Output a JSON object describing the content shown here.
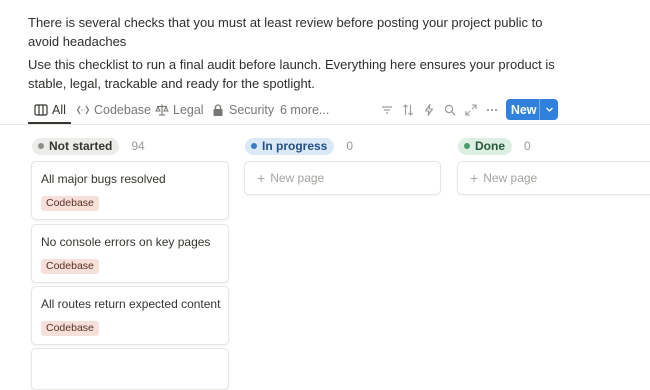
{
  "intro": {
    "paragraph1": "There is several checks that you must at least review before posting your project public to avoid headaches",
    "paragraph2": "Use this checklist to run a final audit before launch. Everything here ensures your product is stable, legal, trackable and ready for the spotlight."
  },
  "tabs": [
    {
      "label": "All",
      "icon": "board-icon",
      "active": true
    },
    {
      "label": "Codebase",
      "icon": "code-icon",
      "active": false
    },
    {
      "label": "Legal",
      "icon": "scale-icon",
      "active": false
    },
    {
      "label": "Security",
      "icon": "lock-icon",
      "active": false
    },
    {
      "label": "6 more...",
      "icon": "",
      "active": false
    }
  ],
  "tools": [
    "filter-icon",
    "sort-icon",
    "lightning-icon",
    "search-icon",
    "expand-icon",
    "more-icon"
  ],
  "new_button": {
    "label": "New"
  },
  "columns": [
    {
      "label": "Not started",
      "count": "94",
      "bg": "#ececea",
      "dot": "#8d8c88",
      "text": "#37352f"
    },
    {
      "label": "In progress",
      "count": "0",
      "bg": "#dbe9f7",
      "dot": "#3a7bc8",
      "text": "#1f4f85"
    },
    {
      "label": "Done",
      "count": "0",
      "bg": "#dcefe2",
      "dot": "#4b9a6b",
      "text": "#28573b"
    }
  ],
  "cards": [
    {
      "title": "All major bugs resolved",
      "tag": "Codebase"
    },
    {
      "title": "No console errors on key pages",
      "tag": "Codebase"
    },
    {
      "title": "All routes return expected content",
      "tag": "Codebase"
    }
  ],
  "new_page_label": "New page"
}
